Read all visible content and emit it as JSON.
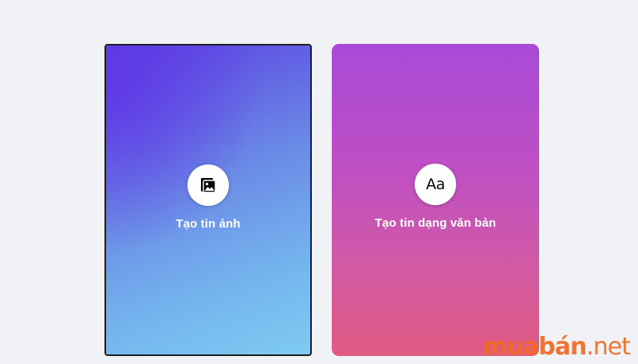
{
  "story_options": [
    {
      "id": "photo",
      "label": "Tạo tin ảnh",
      "icon": "photo-gallery-icon"
    },
    {
      "id": "text",
      "label": "Tạo tin dạng văn bản",
      "icon": "text-aa-icon",
      "icon_text": "Aa"
    }
  ],
  "colors": {
    "page_background": "#f0f2f5",
    "photo_card_gradient": [
      "#5b3fe2",
      "#7ecbf2"
    ],
    "text_card_gradient": [
      "#a84ad8",
      "#e15a82"
    ],
    "watermark": "#f26b22"
  },
  "watermark": {
    "text": "muabán",
    "suffix": ".net"
  }
}
